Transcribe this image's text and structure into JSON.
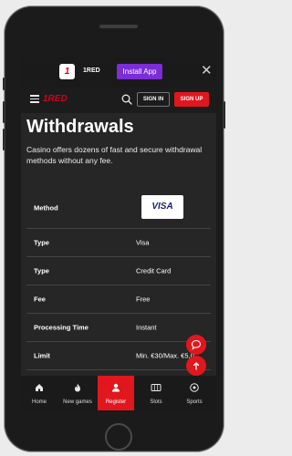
{
  "app_banner": {
    "brand": "1RED",
    "install_label": "Install App",
    "close_symbol": "✕"
  },
  "header": {
    "logo_text": "1RED",
    "signin_label": "SIGN IN",
    "signup_label": "SIGN UP"
  },
  "page": {
    "title": "Withdrawals",
    "subtitle": "Casino offers dozens of fast and secure withdrawal methods without any fee."
  },
  "method_table": {
    "rows": [
      {
        "label": "Method",
        "value": "VISA"
      },
      {
        "label": "Type",
        "value": "Visa"
      },
      {
        "label": "Type",
        "value": "Credit Card"
      },
      {
        "label": "Fee",
        "value": "Free"
      },
      {
        "label": "Processing Time",
        "value": "Instant"
      },
      {
        "label": "Limit",
        "value": "Min. €30/Max. €5,0"
      }
    ]
  },
  "bottom_nav": [
    {
      "label": "Home",
      "icon": "home-icon"
    },
    {
      "label": "New games",
      "icon": "flame-icon"
    },
    {
      "label": "Register",
      "icon": "user-icon",
      "active": true
    },
    {
      "label": "Slots",
      "icon": "slots-icon"
    },
    {
      "label": "Sports",
      "icon": "soccer-ball-icon"
    }
  ],
  "colors": {
    "accent_red": "#e1171e",
    "install_purple": "#7b2dd6",
    "background": "#262626"
  }
}
